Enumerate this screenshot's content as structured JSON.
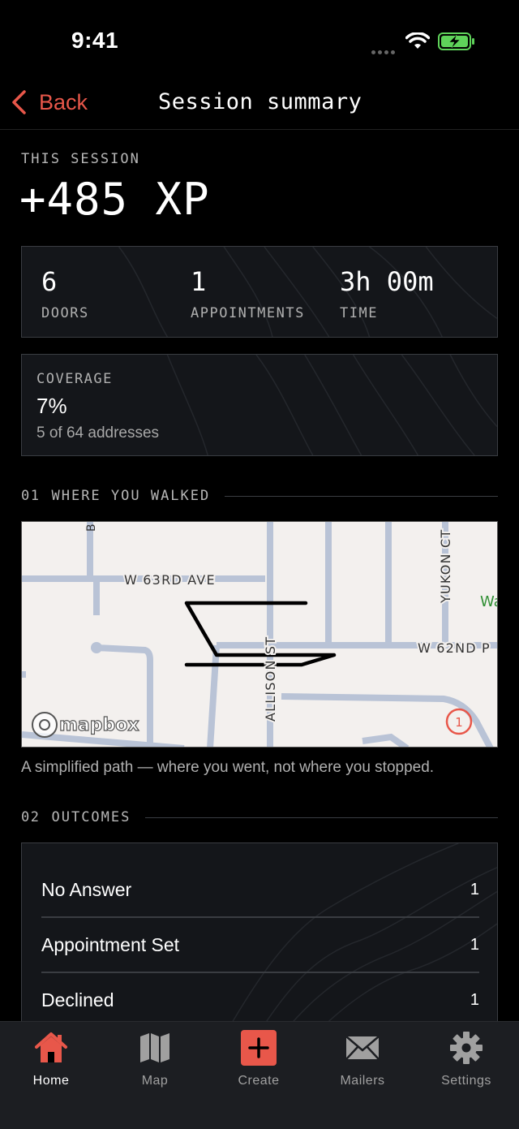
{
  "status": {
    "time": "9:41"
  },
  "nav": {
    "back_label": "Back",
    "title": "Session summary"
  },
  "session": {
    "label": "THIS SESSION",
    "xp": "+485 XP"
  },
  "stats": [
    {
      "value": "6",
      "label": "DOORS"
    },
    {
      "value": "1",
      "label": "APPOINTMENTS"
    },
    {
      "value": "3h 00m",
      "label": "TIME"
    }
  ],
  "coverage": {
    "label": "COVERAGE",
    "percent": "7%",
    "detail": "5 of 64 addresses"
  },
  "sections": {
    "walked": {
      "num": "01",
      "title": "WHERE YOU WALKED"
    },
    "outcomes": {
      "num": "02",
      "title": "OUTCOMES"
    }
  },
  "map": {
    "streets": {
      "w63": "W 63RD AVE",
      "allison": "ALLISON ST",
      "w62": "W 62ND P",
      "yukon": "YUKON CT",
      "b": "B",
      "wa": "Wa"
    },
    "badge": "1",
    "attribution": "mapbox",
    "caption": "A simplified path — where you went, not where you stopped."
  },
  "outcomes": [
    {
      "label": "No Answer",
      "count": "1"
    },
    {
      "label": "Appointment Set",
      "count": "1"
    },
    {
      "label": "Declined",
      "count": "1"
    }
  ],
  "tabs": [
    {
      "label": "Home",
      "icon": "home-icon"
    },
    {
      "label": "Map",
      "icon": "map-icon"
    },
    {
      "label": "Create",
      "icon": "plus-icon"
    },
    {
      "label": "Mailers",
      "icon": "envelope-icon"
    },
    {
      "label": "Settings",
      "icon": "gear-icon"
    }
  ],
  "colors": {
    "accent": "#e8574a",
    "background": "#000000",
    "card": "#14161a",
    "border": "#3a3d42"
  }
}
